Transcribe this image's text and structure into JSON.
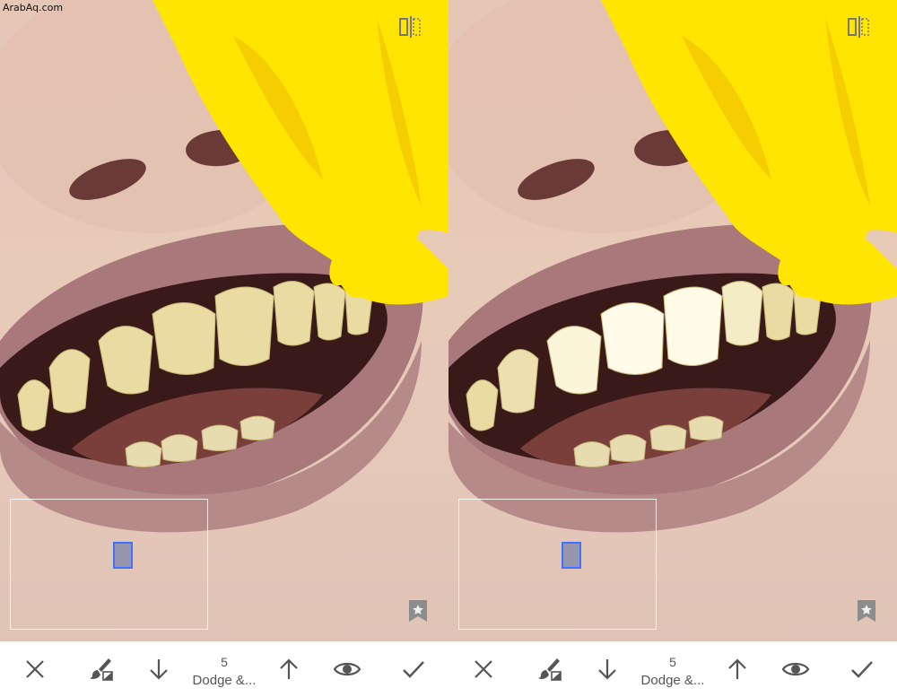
{
  "watermark": "ArabAq.com",
  "panels": [
    {
      "id": "before",
      "toolbar": {
        "brush_value": "5",
        "brush_tool": "Dodge &..."
      }
    },
    {
      "id": "after",
      "toolbar": {
        "brush_value": "5",
        "brush_tool": "Dodge &..."
      }
    }
  ],
  "icons": {
    "close": "close-icon",
    "brush": "brush-mask-icon",
    "decrease": "arrow-down-icon",
    "increase": "arrow-up-icon",
    "visibility": "eye-icon",
    "apply": "checkmark-icon",
    "compare": "compare-icon",
    "bookmark": "bookmark-star-icon"
  },
  "colors": {
    "toolbar_icons": "#555555",
    "navigator_frame": "#3b73ff",
    "petal_yellow": "#ffe500",
    "lip": "#a8787a"
  }
}
